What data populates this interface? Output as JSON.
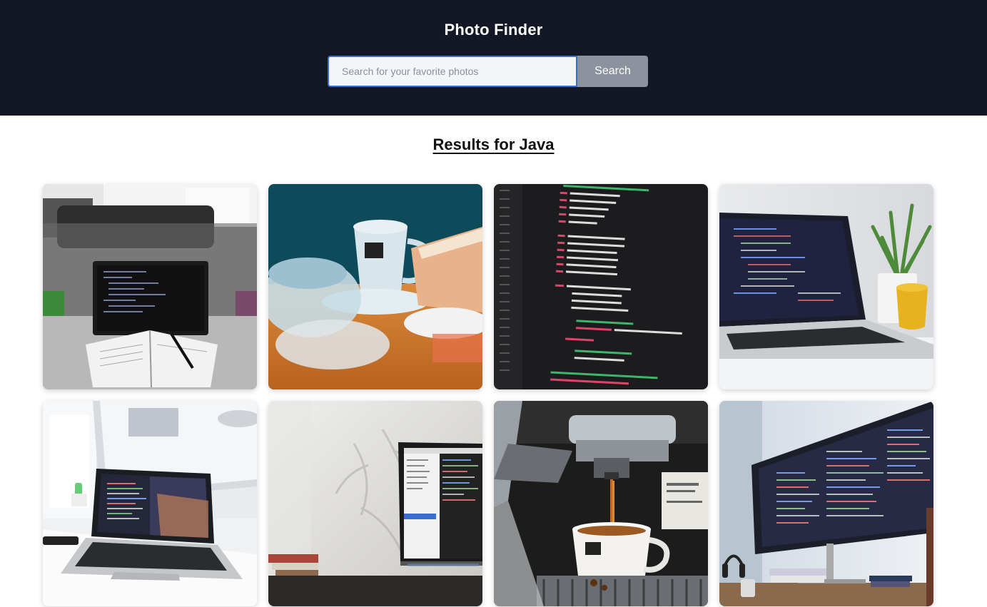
{
  "app": {
    "title": "Photo Finder"
  },
  "search": {
    "placeholder": "Search for your favorite photos",
    "value": "",
    "button_label": "Search"
  },
  "results": {
    "heading": "Results for Java",
    "photos": [
      {
        "id": "photo-1",
        "icon": "laptop-notebook-bw-photo"
      },
      {
        "id": "photo-2",
        "icon": "coffee-cup-cake-photo"
      },
      {
        "id": "photo-3",
        "icon": "code-screen-photo"
      },
      {
        "id": "photo-4",
        "icon": "laptop-plant-mug-photo"
      },
      {
        "id": "photo-5",
        "icon": "laptop-desk-window-photo"
      },
      {
        "id": "photo-6",
        "icon": "laptop-wall-shadow-photo"
      },
      {
        "id": "photo-7",
        "icon": "espresso-machine-photo"
      },
      {
        "id": "photo-8",
        "icon": "monitor-code-photo"
      }
    ]
  },
  "colors": {
    "header_bg": "#141824",
    "button_bg": "#8d939e",
    "input_border": "#3a6fd1"
  }
}
